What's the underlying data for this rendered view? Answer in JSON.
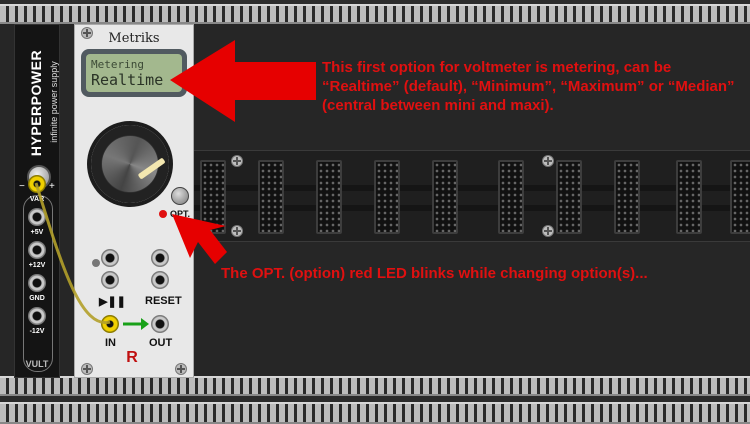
{
  "hyperpower": {
    "title": "HYPERPOWER",
    "subtitle": "infinite power supply",
    "knob_minus": "−",
    "knob_plus": "+",
    "outputs": [
      "VAR",
      "+5V",
      "+12V",
      "GND",
      "-12V"
    ],
    "brand": "VULT"
  },
  "metriks": {
    "title": "Metriks",
    "lcd_line1": "Metering",
    "lcd_line2": "Realtime",
    "opt_label": "OPT.",
    "play_pause_label": "▶❚❚",
    "reset_label": "RESET",
    "in_label": "IN",
    "out_label": "OUT",
    "logo": "R"
  },
  "annotations": {
    "option_note": "This first option for voltmeter is metering, can be “Realtime” (default), “Minimum”, “Maximum” or “Median” (central between mini and maxi).",
    "led_note": "The OPT. (option) red LED blinks while changing option(s)..."
  },
  "colors": {
    "annotation": "#e01010",
    "led": "#e01010",
    "cable": "#b3a02a",
    "lcd_bg": "#a3b88e"
  }
}
